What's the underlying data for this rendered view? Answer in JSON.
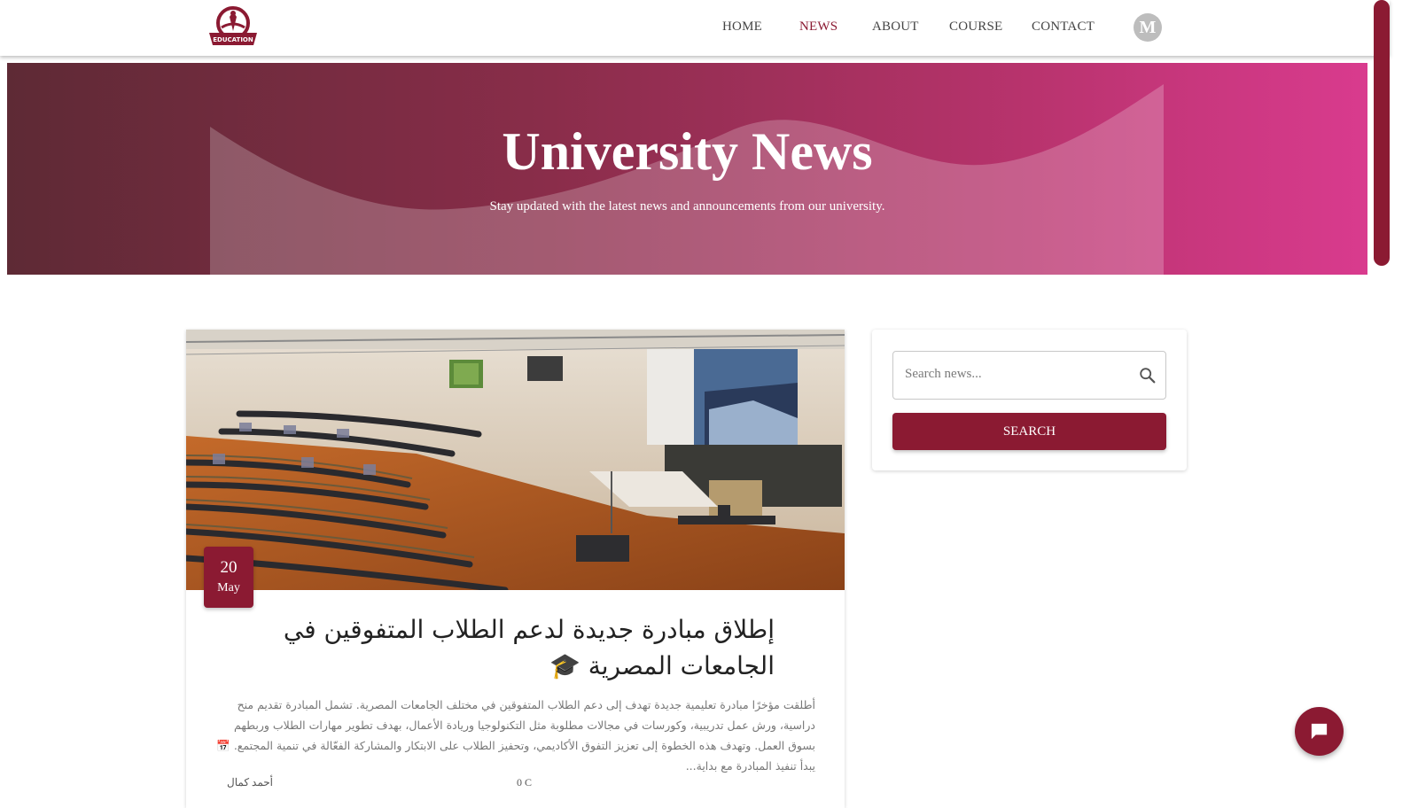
{
  "nav": {
    "logo_text": "EDUCATION",
    "items": [
      {
        "label": "HOME"
      },
      {
        "label": "NEWS"
      },
      {
        "label": "ABOUT"
      },
      {
        "label": "COURSE"
      },
      {
        "label": "CONTACT"
      }
    ],
    "active": "NEWS",
    "avatar_letter": "M"
  },
  "hero": {
    "title": "University News",
    "subtitle": "Stay updated with the latest news and announcements from our university."
  },
  "post": {
    "date_day": "20",
    "date_month": "May",
    "title": "إطلاق مبادرة جديدة لدعم الطلاب المتفوقين في الجامعات المصرية",
    "title_emoji": "🎓",
    "excerpt": "أطلقت مؤخرًا مبادرة تعليمية جديدة تهدف إلى دعم الطلاب المتفوقين في مختلف الجامعات المصرية. تشمل المبادرة تقديم منح دراسية، ورش عمل تدريبية، وكورسات في مجالات مطلوبة مثل التكنولوجيا وريادة الأعمال، بهدف تطوير مهارات الطلاب وربطهم بسوق العمل. وتهدف هذه الخطوة إلى تعزيز التفوق الأكاديمي، وتحفيز الطلاب على الابتكار والمشاركة الفعّالة في تنمية المجتمع. 📅 يبدأ تنفيذ المبادرة مع بداية...",
    "author": "أحمد كمال",
    "comments": "0 C"
  },
  "sidebar": {
    "search_placeholder": "Search news...",
    "search_button": "SEARCH"
  },
  "colors": {
    "brand": "#8b1a32",
    "hero_start": "#5e2a35",
    "hero_end": "#d93b8e"
  },
  "icons": {
    "search": "search-icon",
    "chat": "chat-icon"
  }
}
